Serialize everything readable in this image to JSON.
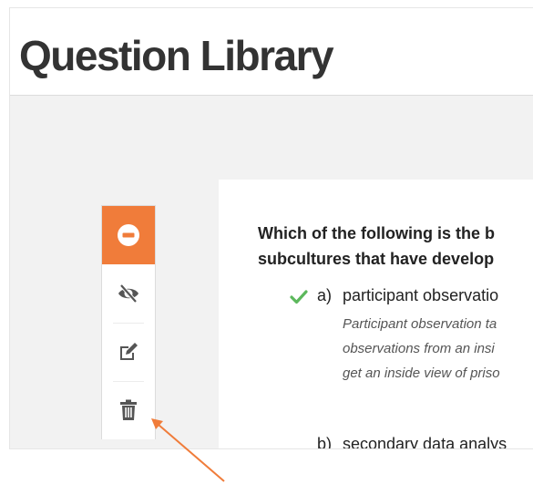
{
  "header": {
    "title": "Question Library"
  },
  "toolbar": {
    "buttons": [
      {
        "name": "remove-icon",
        "active": true
      },
      {
        "name": "hide-icon",
        "active": false
      },
      {
        "name": "edit-icon",
        "active": false
      },
      {
        "name": "delete-icon",
        "active": false
      }
    ]
  },
  "question": {
    "text_line1": "Which of the following is the b",
    "text_line2": "subcultures that have develop",
    "answers": [
      {
        "letter": "a)",
        "text": "participant observatio",
        "correct": true,
        "explanation": [
          "Participant observation ta",
          "observations from an insi",
          "get an inside view of priso"
        ]
      },
      {
        "letter": "b)",
        "text": "secondary data analys",
        "correct": false
      }
    ]
  },
  "colors": {
    "accent": "#f07c3a",
    "check": "#5cb85c",
    "annotation_arrow": "#f07c3a"
  }
}
